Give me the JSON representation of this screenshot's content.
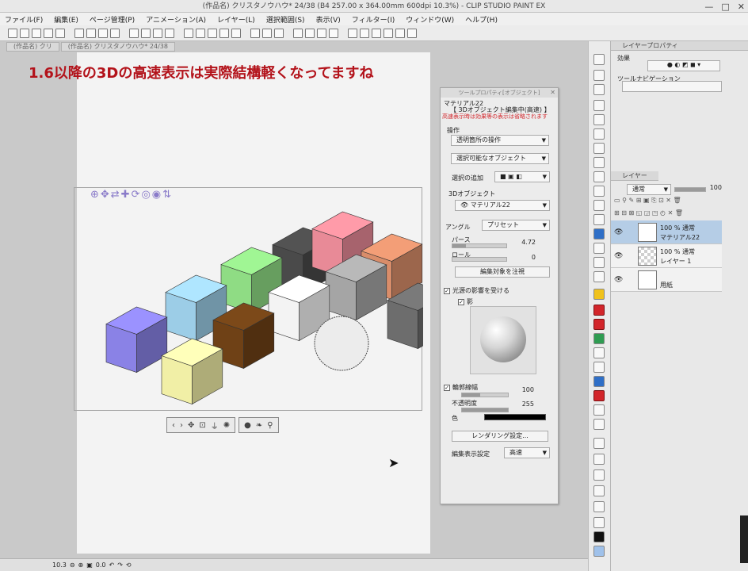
{
  "window": {
    "title": "(作品名) クリスタノウハウ* 24/38 (B4 257.00 x 364.00mm 600dpi 10.3%) - CLIP STUDIO PAINT EX",
    "controls": [
      "—",
      "□",
      "✕"
    ]
  },
  "menu": [
    "ファイル(F)",
    "編集(E)",
    "ページ管理(P)",
    "アニメーション(A)",
    "レイヤー(L)",
    "選択範囲(S)",
    "表示(V)",
    "フィルター(I)",
    "ウィンドウ(W)",
    "ヘルプ(H)"
  ],
  "tabs": [
    "(作品名) クリ",
    "(作品名) クリスタノウハウ* 24/38"
  ],
  "overlay_caption": "1.6以降の3Dの高速表示は実際結構軽くなってますね",
  "tool_property": {
    "title": "ツールプロパティ[オブジェクト]",
    "material_name": "マテリアル22",
    "mode": "【 3Dオブジェクト編集中(高速) 】",
    "warning": "高速表示時は効果等の表示は省略されます",
    "section_operation": "操作",
    "op_transparent": "透明箇所の操作",
    "op_selectable": "選択可能なオブジェクト",
    "selection_add_label": "選択の追加",
    "section_3d": "3Dオブジェクト",
    "object_name": "マテリアル22",
    "angle_label": "アングル",
    "preset_label": "プリセット",
    "perspective_label": "パース",
    "perspective_value": "4.72",
    "roll_label": "ロール",
    "roll_value": "0",
    "focus_button": "編集対象を注視",
    "light_label": "光源の影響を受ける",
    "shadow_label": "影",
    "outline_label": "輪郭線幅",
    "outline_value": "100",
    "opacity_label": "不透明度",
    "opacity_value": "255",
    "color_label": "色",
    "render_button": "レンダリング設定...",
    "display_setting_label": "編集表示設定",
    "display_setting_value": "高速"
  },
  "right_panel": {
    "layer_prop_title": "レイヤープロパティ",
    "effect_label": "効果",
    "tool_nav_label": "ツールナビゲーション",
    "layer_tab": "レイヤー",
    "blend_mode": "通常",
    "opacity": "100",
    "layers": [
      {
        "line1": "100 % 通常",
        "line2": "マテリアル22"
      },
      {
        "line1": "100 % 通常",
        "line2": "レイヤー 1"
      },
      {
        "line1": "",
        "line2": "用紙"
      }
    ]
  },
  "status": {
    "zoom": "10.3",
    "angle": "0.0"
  },
  "colors": {
    "caption": "#b3121a",
    "warning": "#d3262b",
    "selected_layer": "#b5cde6"
  },
  "cubes": [
    {
      "color": "#8a82e6"
    },
    {
      "color": "#9ccde7"
    },
    {
      "color": "#8fdc84"
    },
    {
      "color": "#4a4a4a"
    },
    {
      "color": "#e88a97"
    },
    {
      "color": "#d98d6a"
    },
    {
      "color": "#a5a5a5"
    },
    {
      "color": "#f1efa6"
    },
    {
      "color": "#6f4116"
    },
    {
      "color": "#f3f3f3"
    },
    {
      "color": "#6d6d6d"
    }
  ]
}
